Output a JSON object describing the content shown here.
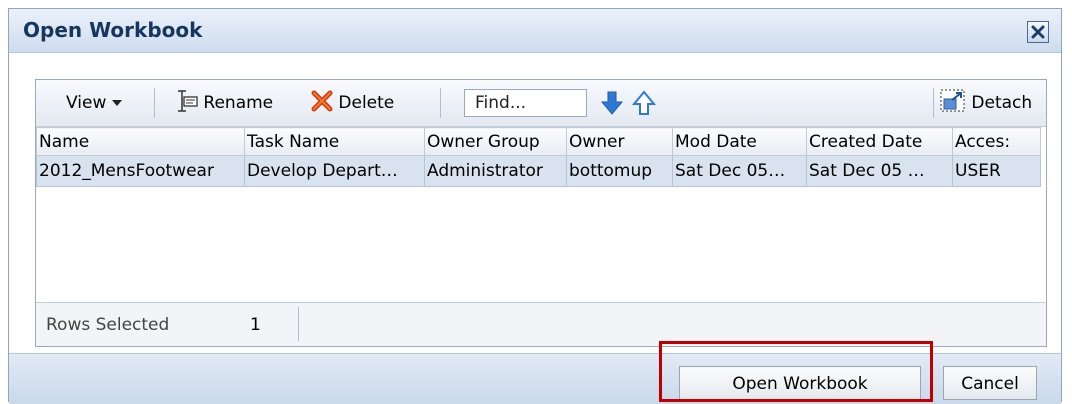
{
  "dialog": {
    "title": "Open Workbook"
  },
  "toolbar": {
    "view_label": "View",
    "rename_label": "Rename",
    "delete_label": "Delete",
    "find_placeholder": "Find...",
    "detach_label": "Detach"
  },
  "table": {
    "columns": [
      "Name",
      "Task Name",
      "Owner Group",
      "Owner",
      "Mod Date",
      "Created Date",
      "Acces:"
    ],
    "rows": [
      [
        "2012_MensFootwear",
        "Develop Depart…",
        "Administrator",
        "bottomup",
        "Sat Dec 05…",
        "Sat Dec 05 …",
        "USER"
      ]
    ]
  },
  "footer": {
    "rows_selected_label": "Rows Selected",
    "rows_selected_count": "1"
  },
  "buttons": {
    "open_label": "Open Workbook",
    "cancel_label": "Cancel"
  },
  "colors": {
    "selected_row": "#d9e2ef",
    "highlight_border": "#c00000",
    "arrow_blue": "#2f79d6"
  }
}
